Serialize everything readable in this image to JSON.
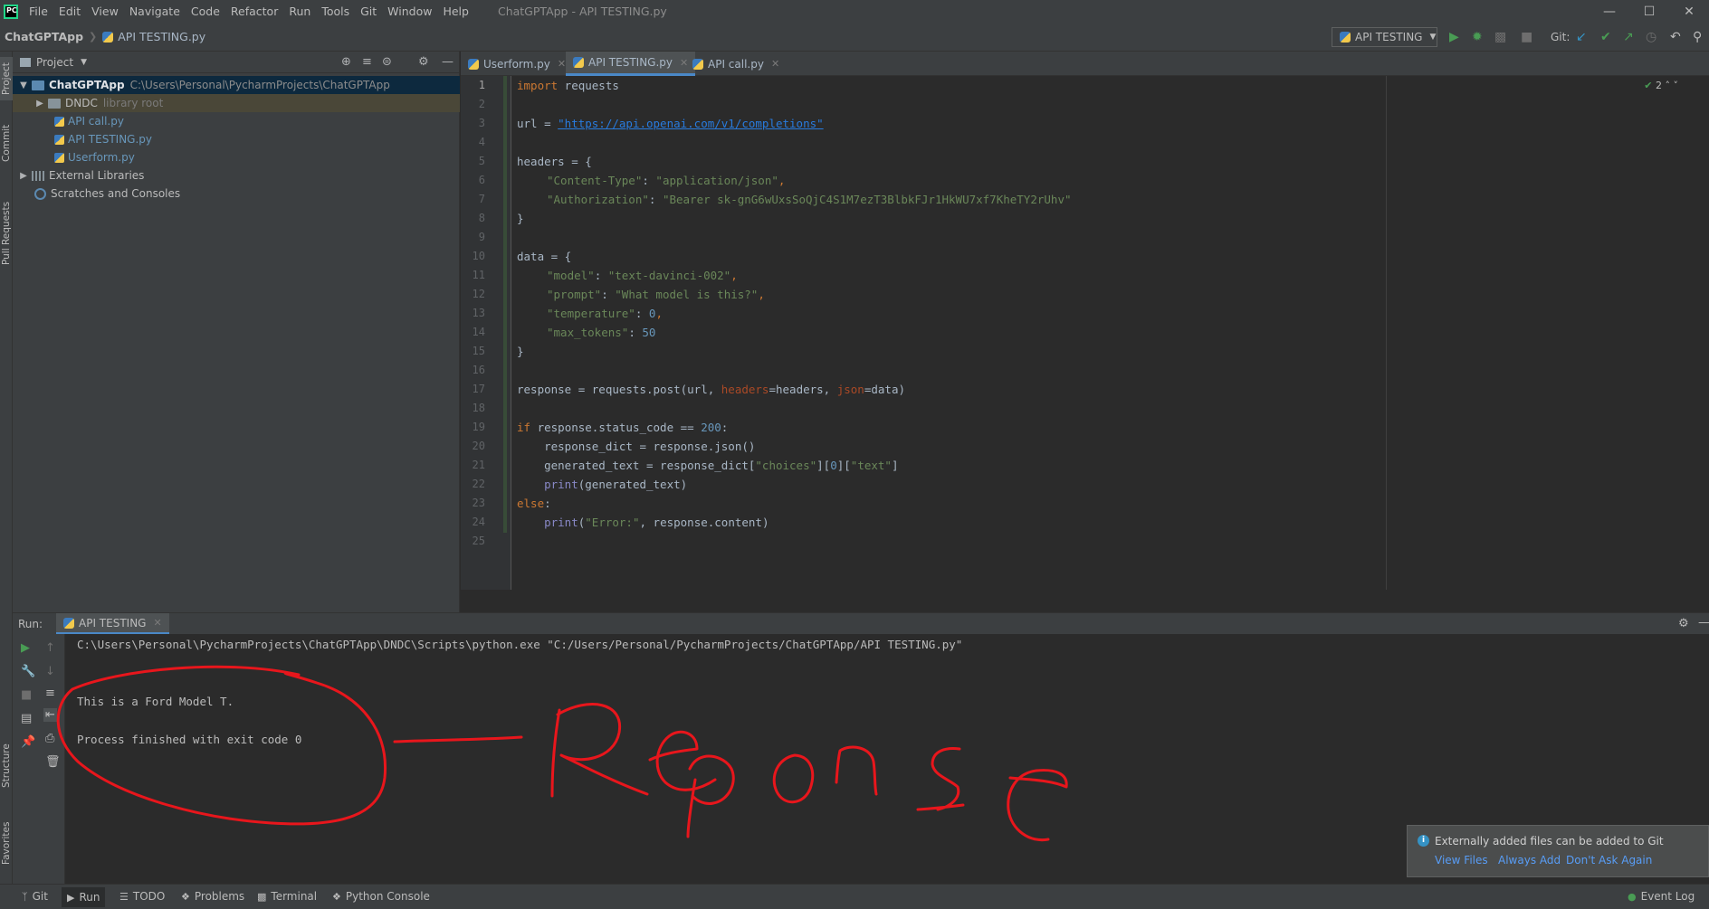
{
  "app": {
    "logo_text": "PC",
    "title": "ChatGPTApp - API TESTING.py",
    "menu": [
      "File",
      "Edit",
      "View",
      "Navigate",
      "Code",
      "Refactor",
      "Run",
      "Tools",
      "Git",
      "Window",
      "Help"
    ]
  },
  "navbar": {
    "project": "ChatGPTApp",
    "file": "API TESTING.py",
    "run_config": "API TESTING",
    "git_label": "Git:"
  },
  "left_stripe": [
    "Project",
    "Commit",
    "Pull Requests",
    "Structure",
    "Favorites"
  ],
  "project_panel": {
    "title": "Project",
    "tree": {
      "root": "ChatGPTApp",
      "root_path": "C:\\Users\\Personal\\PycharmProjects\\ChatGPTApp",
      "lib": "DNDC",
      "lib_note": "library root",
      "files": [
        "API call.py",
        "API TESTING.py",
        "Userform.py"
      ],
      "external": "External Libraries",
      "scratches": "Scratches and Consoles"
    }
  },
  "editor": {
    "tabs": [
      "Userform.py",
      "API TESTING.py",
      "API call.py"
    ],
    "inspection_count": "2",
    "line_numbers": [
      "1",
      "2",
      "3",
      "4",
      "5",
      "6",
      "7",
      "8",
      "9",
      "10",
      "11",
      "12",
      "13",
      "14",
      "15",
      "16",
      "17",
      "18",
      "19",
      "20",
      "21",
      "22",
      "23",
      "24",
      "25"
    ]
  },
  "code_tokens": {
    "l1_kw": "import",
    "l1_rest": " requests",
    "l3_a": "url = ",
    "l3_url": "\"https://api.openai.com/v1/completions\"",
    "l5": "headers = {",
    "l6_k": "\"Content-Type\"",
    "l6_sep": ": ",
    "l6_v": "\"application/json\"",
    "l6_end": ",",
    "l7_k": "\"Authorization\"",
    "l7_sep": ": ",
    "l7_v": "\"Bearer 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\"",
    "l8": "}",
    "l10": "data = {",
    "l11_k": "\"model\"",
    "l11_sep": ": ",
    "l11_v": "\"text-davinci-002\"",
    "l11_end": ",",
    "l12_k": "\"prompt\"",
    "l12_sep": ": ",
    "l12_v": "\"What model is this?\"",
    "l12_end": ",",
    "l13_k": "\"temperature\"",
    "l13_sep": ": ",
    "l13_v": "0",
    "l13_end": ",",
    "l14_k": "\"max_tokens\"",
    "l14_sep": ": ",
    "l14_v": "50",
    "l15": "}",
    "l17_a": "response = requests.post(url, ",
    "l17_p1": "headers",
    "l17_b": "=headers, ",
    "l17_p2": "json",
    "l17_c": "=data)",
    "l19_kw": "if",
    "l19_a": " response.status_code == ",
    "l19_n": "200",
    "l19_b": ":",
    "l20": "    response_dict = response.json()",
    "l21_a": "    generated_text = response_dict[",
    "l21_s1": "\"choices\"",
    "l21_b": "][",
    "l21_n": "0",
    "l21_c": "][",
    "l21_s2": "\"text\"",
    "l21_d": "]",
    "l22_ind": "    ",
    "l22_fn": "print",
    "l22_rest": "(generated_text)",
    "l23_kw": "else",
    "l23_b": ":",
    "l24_ind": "    ",
    "l24_fn": "print",
    "l24_a": "(",
    "l24_s": "\"Error:\"",
    "l24_rest": ", response.content)"
  },
  "run_panel": {
    "label": "Run:",
    "tab": "API TESTING",
    "console": [
      "C:\\Users\\Personal\\PycharmProjects\\ChatGPTApp\\DNDC\\Scripts\\python.exe \"C:/Users/Personal/PycharmProjects/ChatGPTApp/API TESTING.py\"",
      "",
      "This is a Ford Model T.",
      "",
      "Process finished with exit code 0"
    ]
  },
  "annotation": {
    "text": "Reponse",
    "color": "#e8161c"
  },
  "notification": {
    "text": "Externally added files can be added to Git",
    "links": [
      "View Files",
      "Always Add",
      "Don't Ask Again"
    ]
  },
  "statusbar": {
    "items": [
      "Git",
      "Run",
      "TODO",
      "Problems",
      "Terminal",
      "Python Console"
    ],
    "event_log": "Event Log"
  },
  "colors": {
    "accent": "#4a88c7",
    "run_green": "#499c54",
    "keyword": "#cc7832",
    "string": "#6a8759",
    "number": "#6897bb"
  }
}
